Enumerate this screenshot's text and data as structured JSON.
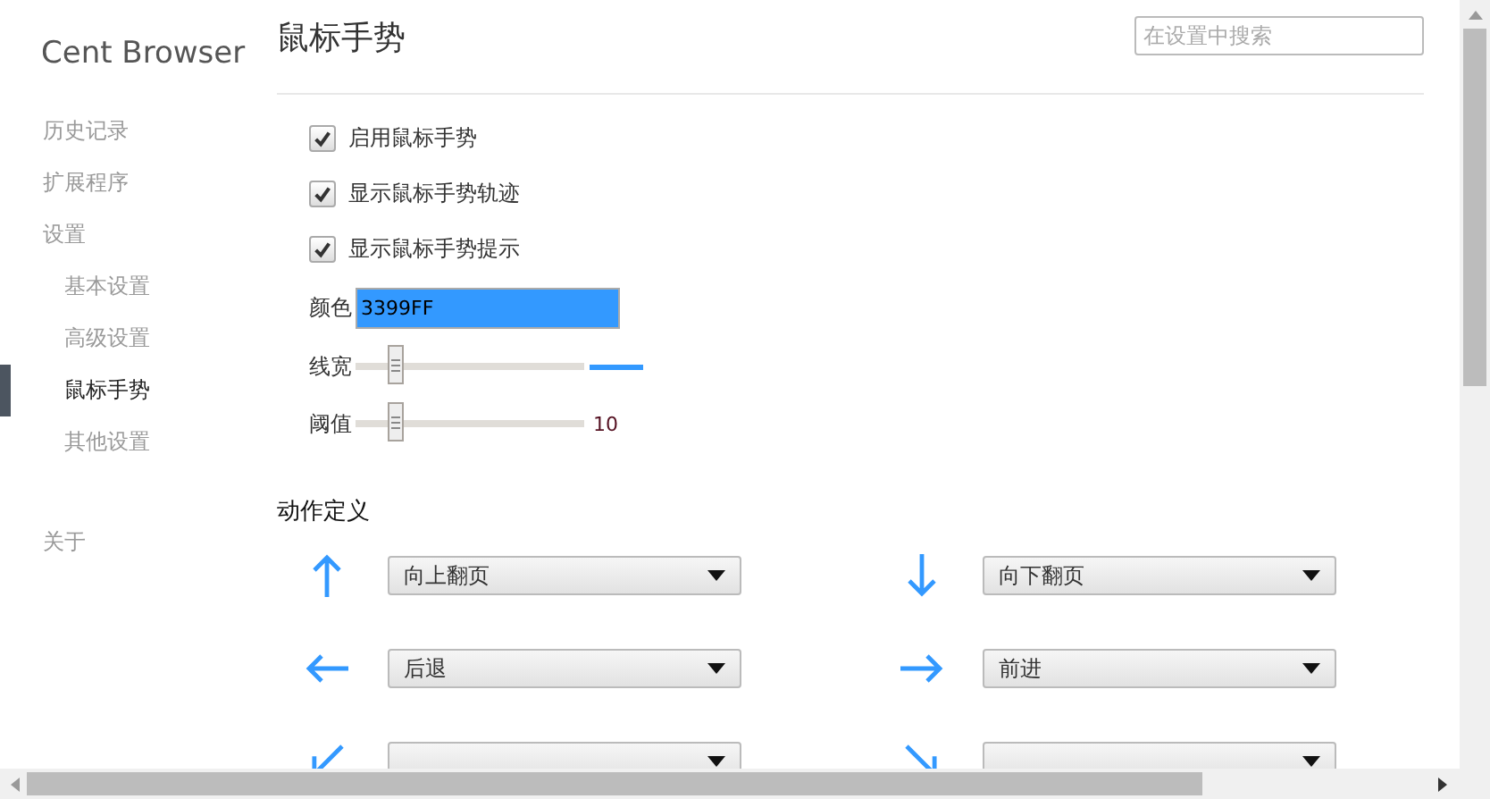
{
  "sidebar": {
    "brand": "Cent Browser",
    "items": [
      {
        "label": "历史记录",
        "selected": false
      },
      {
        "label": "扩展程序",
        "selected": false
      },
      {
        "label": "设置",
        "selected": false,
        "children": [
          {
            "label": "基本设置",
            "selected": false
          },
          {
            "label": "高级设置",
            "selected": false
          },
          {
            "label": "鼠标手势",
            "selected": true
          },
          {
            "label": "其他设置",
            "selected": false
          }
        ]
      },
      {
        "label": "关于",
        "selected": false,
        "kind": "gap"
      }
    ]
  },
  "header": {
    "title": "鼠标手势",
    "search": {
      "placeholder": "在设置中搜索"
    }
  },
  "options": [
    {
      "label": "启用鼠标手势",
      "checked": true
    },
    {
      "label": "显示鼠标手势轨迹",
      "checked": true
    },
    {
      "label": "显示鼠标手势提示",
      "checked": true
    }
  ],
  "color": {
    "label": "颜色",
    "value": "3399FF"
  },
  "sliders": [
    {
      "label": "线宽",
      "kind": "line"
    },
    {
      "label": "阈值",
      "reading": "10",
      "kind": "number"
    }
  ],
  "actions": {
    "title": "动作定义",
    "gestures": [
      {
        "kind": "up",
        "label": "向上翻页"
      },
      {
        "kind": "down",
        "label": "向下翻页"
      },
      {
        "kind": "left",
        "label": "后退"
      },
      {
        "kind": "right",
        "label": "前进"
      },
      {
        "kind": "downleft"
      },
      {
        "kind": "downright"
      }
    ]
  }
}
